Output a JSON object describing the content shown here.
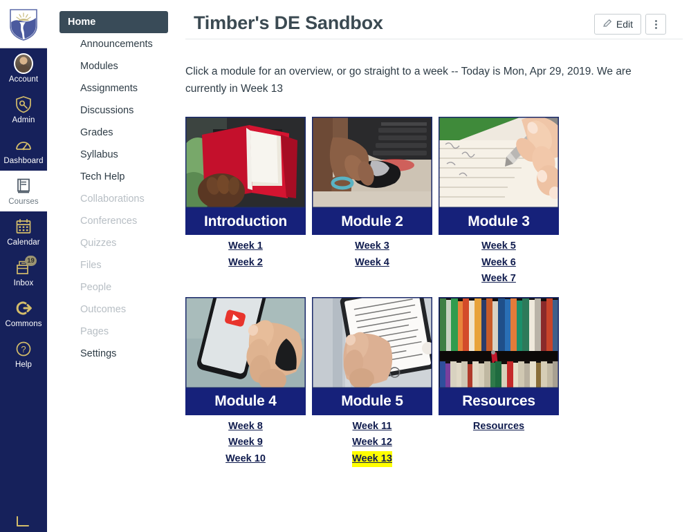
{
  "global_nav": {
    "logo_name": "university-shield-logo",
    "items": [
      {
        "label": "Account",
        "icon": "avatar-icon",
        "active": false,
        "badge": null
      },
      {
        "label": "Admin",
        "icon": "shield-wrench-icon",
        "active": false,
        "badge": null
      },
      {
        "label": "Dashboard",
        "icon": "dashboard-gauge-icon",
        "active": false,
        "badge": null
      },
      {
        "label": "Courses",
        "icon": "book-icon",
        "active": true,
        "badge": null
      },
      {
        "label": "Calendar",
        "icon": "calendar-icon",
        "active": false,
        "badge": null
      },
      {
        "label": "Inbox",
        "icon": "inbox-tray-icon",
        "active": false,
        "badge": "19"
      },
      {
        "label": "Commons",
        "icon": "commons-arrow-icon",
        "active": false,
        "badge": null
      },
      {
        "label": "Help",
        "icon": "question-circle-icon",
        "active": false,
        "badge": null
      }
    ],
    "collapse_label": "collapse-nav-arrow"
  },
  "course_nav": {
    "items": [
      {
        "label": "Home",
        "state": "active"
      },
      {
        "label": "Announcements",
        "state": "normal"
      },
      {
        "label": "Modules",
        "state": "normal"
      },
      {
        "label": "Assignments",
        "state": "normal"
      },
      {
        "label": "Discussions",
        "state": "normal"
      },
      {
        "label": "Grades",
        "state": "normal"
      },
      {
        "label": "Syllabus",
        "state": "normal"
      },
      {
        "label": "Tech Help",
        "state": "normal"
      },
      {
        "label": "Collaborations",
        "state": "muted"
      },
      {
        "label": "Conferences",
        "state": "muted"
      },
      {
        "label": "Quizzes",
        "state": "muted"
      },
      {
        "label": "Files",
        "state": "muted"
      },
      {
        "label": "People",
        "state": "muted"
      },
      {
        "label": "Outcomes",
        "state": "muted"
      },
      {
        "label": "Pages",
        "state": "muted"
      },
      {
        "label": "Settings",
        "state": "normal"
      }
    ]
  },
  "header": {
    "title": "Timber's DE Sandbox",
    "edit_label": "Edit",
    "kebab_label": "More options"
  },
  "main": {
    "intro": "Click a module for an overview, or go straight to a week -- Today is Mon, Apr 29, 2019. We are currently in Week 13",
    "cards": [
      {
        "title": "Introduction",
        "image": "person-reading-red-book",
        "weeks": [
          {
            "label": "Week 1",
            "highlight": false
          },
          {
            "label": "Week 2",
            "highlight": false
          }
        ]
      },
      {
        "title": "Module 2",
        "image": "hands-on-computer-mouse-keyboard",
        "weeks": [
          {
            "label": "Week 3",
            "highlight": false
          },
          {
            "label": "Week 4",
            "highlight": false
          }
        ]
      },
      {
        "title": "Module 3",
        "image": "hand-writing-with-pen-on-notebook",
        "weeks": [
          {
            "label": "Week 5",
            "highlight": false
          },
          {
            "label": "Week 6",
            "highlight": false
          },
          {
            "label": "Week 7",
            "highlight": false
          }
        ]
      },
      {
        "title": "Module 4",
        "image": "hand-holding-phone-with-video-app",
        "weeks": [
          {
            "label": "Week 8",
            "highlight": false
          },
          {
            "label": "Week 9",
            "highlight": false
          },
          {
            "label": "Week 10",
            "highlight": false
          }
        ]
      },
      {
        "title": "Module 5",
        "image": "hand-holding-e-reader-tablet",
        "weeks": [
          {
            "label": "Week 11",
            "highlight": false
          },
          {
            "label": "Week 12",
            "highlight": false
          },
          {
            "label": "Week 13",
            "highlight": true
          }
        ]
      },
      {
        "title": "Resources",
        "image": "bookshelf-full-of-books",
        "weeks": [
          {
            "label": "Resources",
            "highlight": false
          }
        ]
      }
    ]
  },
  "colors": {
    "global_nav_bg": "#16215b",
    "card_title_bg": "#16217a",
    "active_course_nav_bg": "#394b58",
    "highlight": "#ffff00",
    "icon_gold": "#d4bd6a"
  }
}
